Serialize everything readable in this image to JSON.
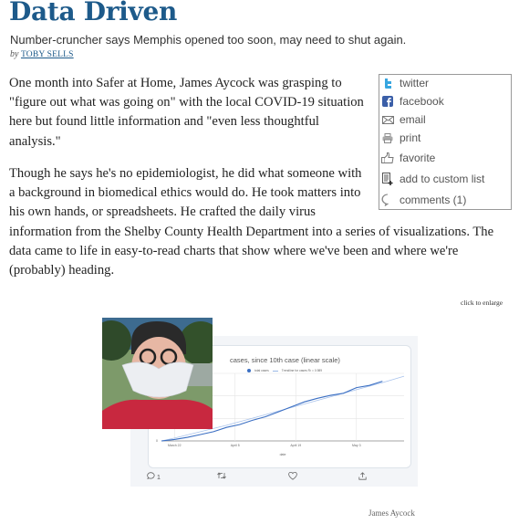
{
  "header": {
    "title": "Data Driven",
    "subtitle": "Number-cruncher says Memphis opened too soon, may need to shut again.",
    "byline_prefix": "by",
    "author": "TOBY SELLS"
  },
  "share": {
    "items": [
      {
        "icon": "twitter-icon",
        "label": "twitter"
      },
      {
        "icon": "facebook-icon",
        "label": "facebook"
      },
      {
        "icon": "email-icon",
        "label": "email"
      },
      {
        "icon": "print-icon",
        "label": "print"
      },
      {
        "icon": "thumbs-up-icon",
        "label": "favorite"
      },
      {
        "icon": "add-list-icon",
        "label": "add to custom list"
      },
      {
        "icon": "comment-icon",
        "label": "comments (1)"
      }
    ]
  },
  "article": {
    "paragraphs": [
      "One month into Safer at Home, James Aycock was grasping to \"figure out what was going on\" with the local COVID-19 situation here but found little information and \"even less thoughtful analysis.\"",
      "Though he says he's no epidemiologist, he did what someone with a background in biomedical ethics would do. He took matters into his own hands, or spreadsheets. He crafted the daily virus information from the Shelby County Health Department into a series of visualizations. The data came to life in easy-to-read charts that show where we've been and where we're (probably) heading."
    ]
  },
  "figure": {
    "enlarge_label": "click to enlarge",
    "credit": "James Aycock",
    "tweet": {
      "reply_count": "1"
    }
  },
  "chart_data": {
    "type": "line",
    "title": "cases, since 10th case (linear scale)",
    "legend": [
      "total cases",
      "Trendline for cases R² = 0.989"
    ],
    "legend_position": "top",
    "xlabel": "date",
    "ylabel": "",
    "x_ticks": [
      "March 22",
      "April 5",
      "April 19",
      "May 3"
    ],
    "y_ticks": [
      "0"
    ],
    "grid": true,
    "x": [
      0,
      3,
      6,
      9,
      12,
      15,
      18,
      21,
      24,
      27,
      30,
      33,
      36,
      39,
      42,
      45,
      48,
      51
    ],
    "series": [
      {
        "name": "total cases",
        "values": [
          0,
          2,
          5,
          9,
          13,
          19,
          23,
          29,
          34,
          41,
          48,
          55,
          60,
          64,
          67,
          75,
          78,
          84
        ]
      },
      {
        "name": "Trendline for cases",
        "values": [
          0,
          4,
          8.5,
          13,
          17.5,
          22,
          27,
          32,
          37,
          42,
          47,
          52,
          57,
          62,
          67,
          72,
          77,
          82
        ]
      }
    ]
  }
}
